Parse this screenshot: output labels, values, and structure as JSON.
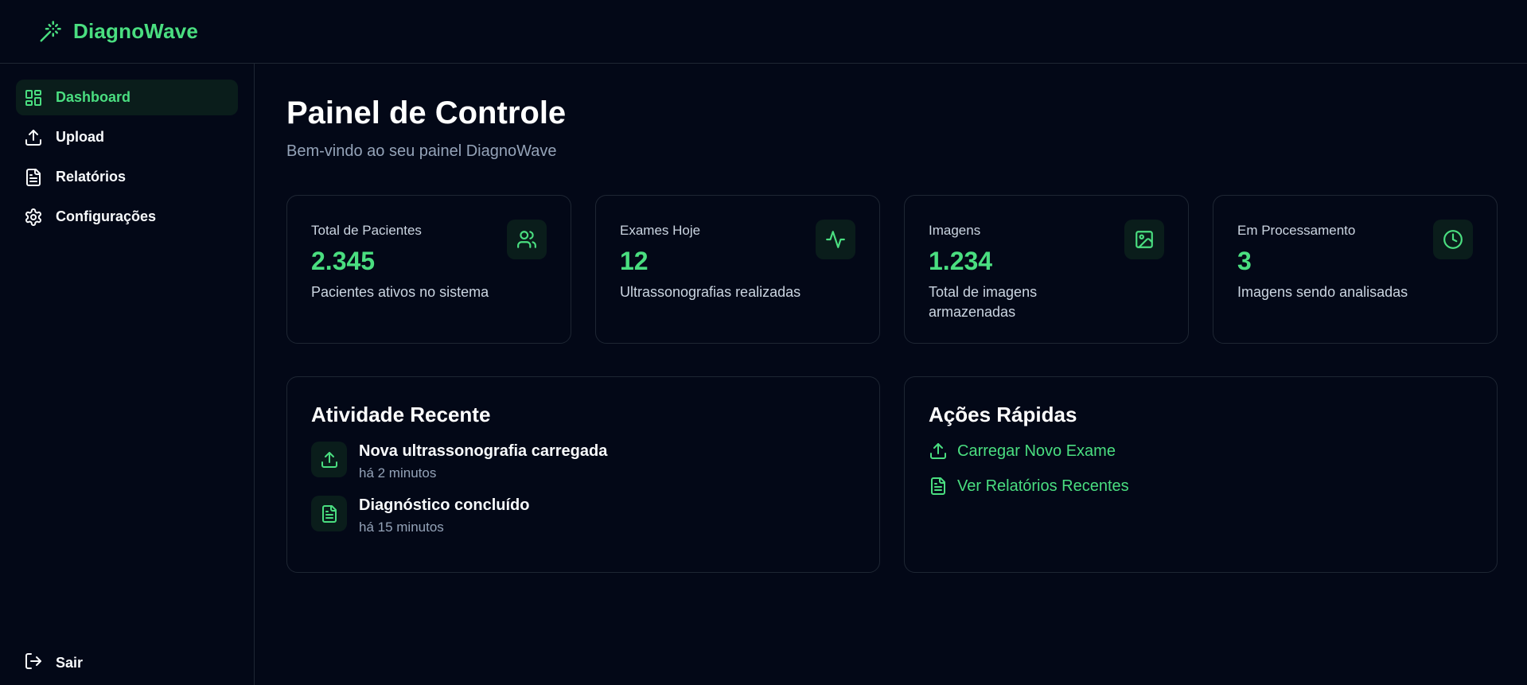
{
  "app": {
    "brand_name": "DiagnoWave",
    "accent_color": "#4ade80",
    "background_color": "#030817"
  },
  "sidebar": {
    "items": [
      {
        "label": "Dashboard",
        "icon": "dashboard-grid-icon",
        "active": true
      },
      {
        "label": "Upload",
        "icon": "upload-icon",
        "active": false
      },
      {
        "label": "Relatórios",
        "icon": "document-icon",
        "active": false
      },
      {
        "label": "Configurações",
        "icon": "gear-icon",
        "active": false
      }
    ],
    "logout_label": "Sair"
  },
  "main": {
    "title": "Painel de Controle",
    "subtitle": "Bem-vindo ao seu painel DiagnoWave",
    "stats": [
      {
        "label": "Total de Pacientes",
        "value": "2.345",
        "description": "Pacientes ativos no sistema",
        "icon": "users-icon"
      },
      {
        "label": "Exames Hoje",
        "value": "12",
        "description": "Ultrassonografias realizadas",
        "icon": "activity-pulse-icon"
      },
      {
        "label": "Imagens",
        "value": "1.234",
        "description": "Total de imagens armazenadas",
        "icon": "image-icon"
      },
      {
        "label": "Em Processamento",
        "value": "3",
        "description": "Imagens sendo analisadas",
        "icon": "clock-icon"
      }
    ],
    "recent_activity": {
      "title": "Atividade Recente",
      "items": [
        {
          "title": "Nova ultrassonografia carregada",
          "time": "há 2 minutos",
          "icon": "upload-icon"
        },
        {
          "title": "Diagnóstico concluído",
          "time": "há 15 minutos",
          "icon": "document-icon"
        }
      ]
    },
    "quick_actions": {
      "title": "Ações Rápidas",
      "items": [
        {
          "label": "Carregar Novo Exame",
          "icon": "upload-icon"
        },
        {
          "label": "Ver Relatórios Recentes",
          "icon": "document-icon"
        }
      ]
    }
  }
}
